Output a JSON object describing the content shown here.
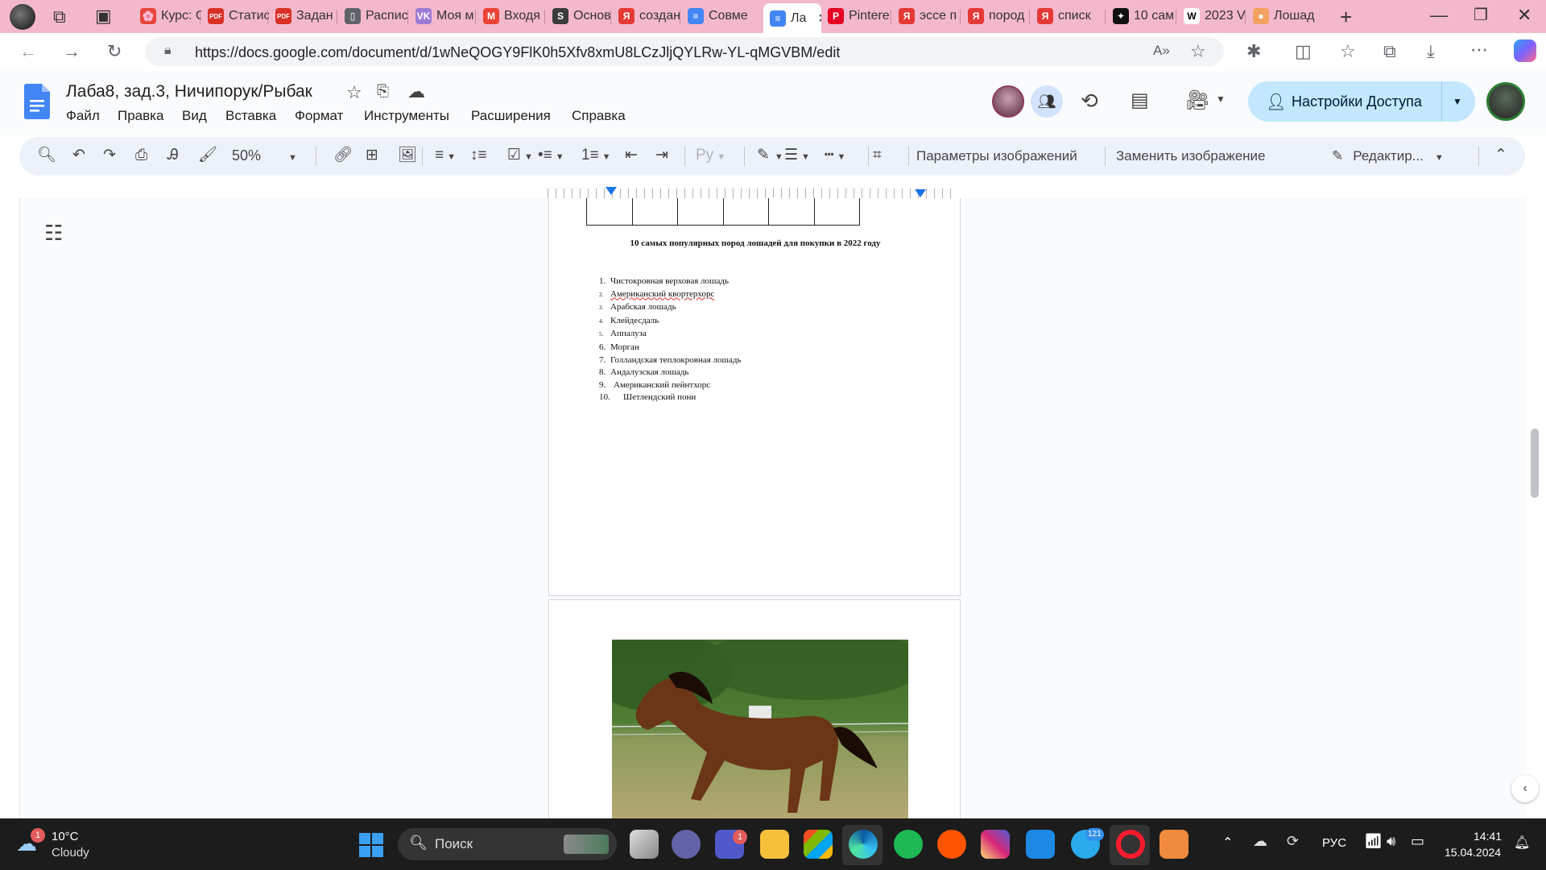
{
  "browser": {
    "tabs": [
      {
        "label": "Курс: С",
        "color": "#e8453c",
        "glyph": "🌸"
      },
      {
        "label": "Статис",
        "color": "#d93025",
        "glyph": "PDF"
      },
      {
        "label": "Задан",
        "color": "#d93025",
        "glyph": "PDF"
      },
      {
        "label": "Распис",
        "color": "#5f6368",
        "glyph": "▯"
      },
      {
        "label": "Моя м",
        "color": "#9c7ad6",
        "glyph": "VK"
      },
      {
        "label": "Входя",
        "color": "#ea4335",
        "glyph": "M"
      },
      {
        "label": "Основ",
        "color": "#3c3c3c",
        "glyph": "S"
      },
      {
        "label": "создан",
        "color": "#e53935",
        "glyph": "Я"
      },
      {
        "label": "Совме",
        "color": "#4285f4",
        "glyph": "≡"
      },
      {
        "label": "Ла",
        "color": "#4285f4",
        "glyph": "≡"
      },
      {
        "label": "Pintere",
        "color": "#e60023",
        "glyph": "P"
      },
      {
        "label": "эссе п",
        "color": "#e53935",
        "glyph": "Я"
      },
      {
        "label": "пород",
        "color": "#e53935",
        "glyph": "Я"
      },
      {
        "label": "списк",
        "color": "#e53935",
        "glyph": "Я"
      },
      {
        "label": "10 сам",
        "color": "#111111",
        "glyph": "✦"
      },
      {
        "label": "2023 V",
        "color": "#ffffff",
        "glyph": "W"
      },
      {
        "label": "Лошад",
        "color": "#f4a261",
        "glyph": "●"
      }
    ],
    "url": "https://docs.google.com/document/d/1wNeQOGY9FlK0h5Xfv8xmU8LCzJljQYLRw-YL-qMGVBM/edit"
  },
  "docs": {
    "title": "Лаба8, зад.3, Ничипорук/Рыбак",
    "menu": [
      "Файл",
      "Правка",
      "Вид",
      "Вставка",
      "Формат",
      "Инструменты",
      "Расширения",
      "Справка"
    ],
    "share_label": "Настройки Доступа",
    "toolbar": {
      "zoom": "50%",
      "image_options": "Параметры изображений",
      "replace_image": "Заменить изображение",
      "editing_mode": "Редактир..."
    },
    "accent": "#1a73e8"
  },
  "document": {
    "heading": "10 самых популярных пород лошадей для покупки в 2022 году",
    "list": [
      {
        "num": "1.",
        "text": "Чистокровная верховая лошадь"
      },
      {
        "num": "2.",
        "text": "Американский квортерхорс"
      },
      {
        "num": "3.",
        "text": "Арабская лошадь"
      },
      {
        "num": "4.",
        "text": "Клейдесдаль"
      },
      {
        "num": "5.",
        "text": "Аппалуза"
      },
      {
        "num": "6.",
        "text": "Морган"
      },
      {
        "num": "7.",
        "text": "Голландская теплокровная лошадь"
      },
      {
        "num": "8.",
        "text": "Андалузская лошадь"
      },
      {
        "num": "9.",
        "text": "Американский пейнтхорс"
      },
      {
        "num": "10.",
        "text": "Шетлендский пони"
      }
    ]
  },
  "taskbar": {
    "weather_temp": "10°C",
    "weather_desc": "Cloudy",
    "weather_badge": "1",
    "search_label": "Поиск",
    "teams_badge": "1",
    "telegram_badge": "121",
    "language": "РУС",
    "time": "14:41",
    "date": "15.04.2024"
  }
}
